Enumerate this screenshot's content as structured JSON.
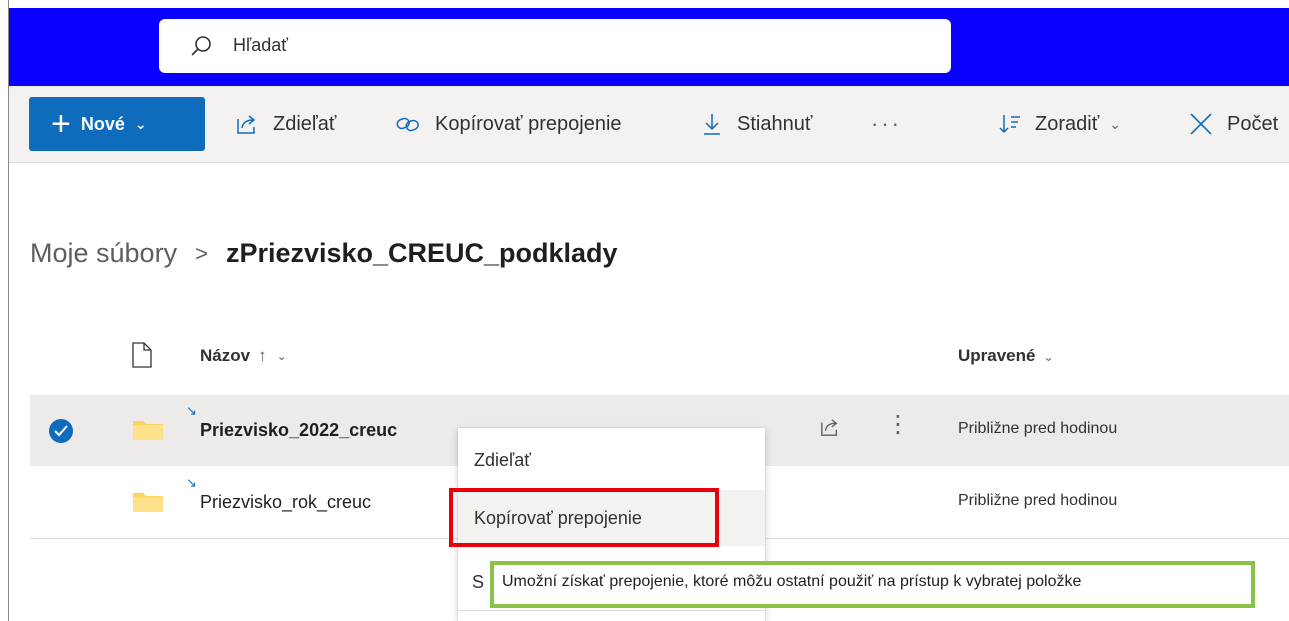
{
  "search": {
    "placeholder": "Hľadať"
  },
  "toolbar": {
    "new_label": "Nové",
    "share_label": "Zdieľať",
    "copy_link_label": "Kopírovať prepojenie",
    "download_label": "Stiahnuť",
    "more_label": "···",
    "sort_label": "Zoradiť",
    "count_label": "Počet"
  },
  "breadcrumb": {
    "root": "Moje súbory",
    "separator": ">",
    "current": "zPriezvisko_CREUC_podklady"
  },
  "table": {
    "columns": {
      "name": "Názov",
      "name_sort_arrow": "↑",
      "modified": "Upravené"
    },
    "rows": [
      {
        "name": "Priezvisko_2022_creuc",
        "modified": "Približne pred hodinou",
        "selected": true
      },
      {
        "name": "Priezvisko_rok_creuc",
        "modified": "Približne pred hodinou",
        "selected": false
      }
    ]
  },
  "context_menu": {
    "items": [
      "Zdieľať",
      "Kopírovať prepojenie",
      "S"
    ]
  },
  "tooltip": {
    "text": "Umožní získať prepojenie, ktoré môžu ostatní použiť na prístup k vybratej položke"
  },
  "colors": {
    "topbar": "#0a00ff",
    "primary": "#0f6cbd",
    "highlight_red": "#e8000b",
    "highlight_green": "#8bc34a",
    "folder": "#ffd35b"
  },
  "icons": [
    "search-icon",
    "plus-icon",
    "share-icon",
    "link-icon",
    "download-icon",
    "sort-icon",
    "close-icon",
    "file-icon",
    "folder-icon",
    "checkmark-icon",
    "more-vertical-icon"
  ]
}
